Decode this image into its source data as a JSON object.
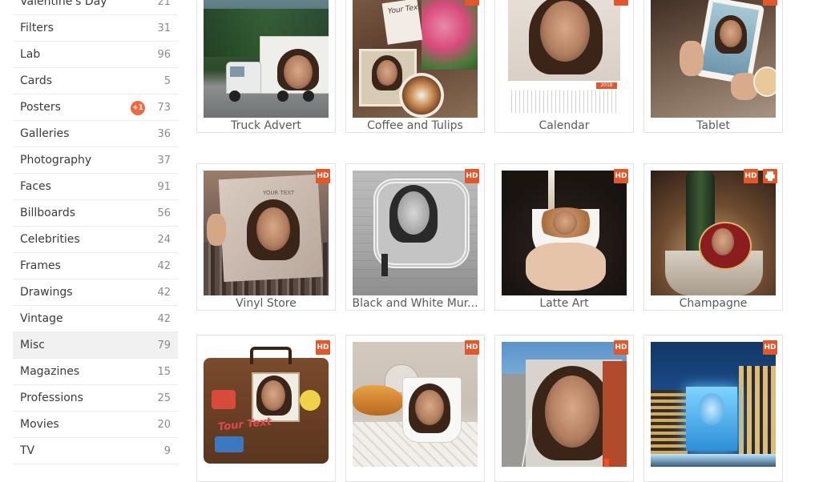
{
  "sidebar": {
    "categories": [
      {
        "label": "Valentine's Day",
        "count": "21"
      },
      {
        "label": "Filters",
        "count": "31"
      },
      {
        "label": "Lab",
        "count": "96"
      },
      {
        "label": "Cards",
        "count": "5"
      },
      {
        "label": "Posters",
        "count": "73",
        "badge": "+1"
      },
      {
        "label": "Galleries",
        "count": "36"
      },
      {
        "label": "Photography",
        "count": "37"
      },
      {
        "label": "Faces",
        "count": "91"
      },
      {
        "label": "Billboards",
        "count": "56"
      },
      {
        "label": "Celebrities",
        "count": "24"
      },
      {
        "label": "Frames",
        "count": "42"
      },
      {
        "label": "Drawings",
        "count": "42"
      },
      {
        "label": "Vintage",
        "count": "42"
      },
      {
        "label": "Misc",
        "count": "79"
      },
      {
        "label": "Magazines",
        "count": "15"
      },
      {
        "label": "Professions",
        "count": "25"
      },
      {
        "label": "Movies",
        "count": "20"
      },
      {
        "label": "TV",
        "count": "9"
      }
    ]
  },
  "badges": {
    "hd": "HD"
  },
  "thumb_text": {
    "your_text": "Your Text",
    "calendar_year": "2018",
    "tour_text": "Tour Text"
  },
  "effects": [
    {
      "title": "Truck Advert",
      "hd": false,
      "print": false
    },
    {
      "title": "Coffee and Tulips",
      "hd": true,
      "print": false
    },
    {
      "title": "Calendar",
      "hd": true,
      "print": false
    },
    {
      "title": "Tablet",
      "hd": true,
      "print": false
    },
    {
      "title": "Vinyl Store",
      "hd": true,
      "print": false
    },
    {
      "title": "Black and White Mur...",
      "hd": true,
      "print": false
    },
    {
      "title": "Latte Art",
      "hd": true,
      "print": false
    },
    {
      "title": "Champagne",
      "hd": true,
      "print": true
    },
    {
      "title": "",
      "hd": true,
      "print": false
    },
    {
      "title": "",
      "hd": true,
      "print": false
    },
    {
      "title": "",
      "hd": true,
      "print": false
    },
    {
      "title": "",
      "hd": true,
      "print": false
    }
  ],
  "colors": {
    "accent": "#e3572a",
    "badge": "#f0693f",
    "active_bg": "#f1f1f1"
  }
}
